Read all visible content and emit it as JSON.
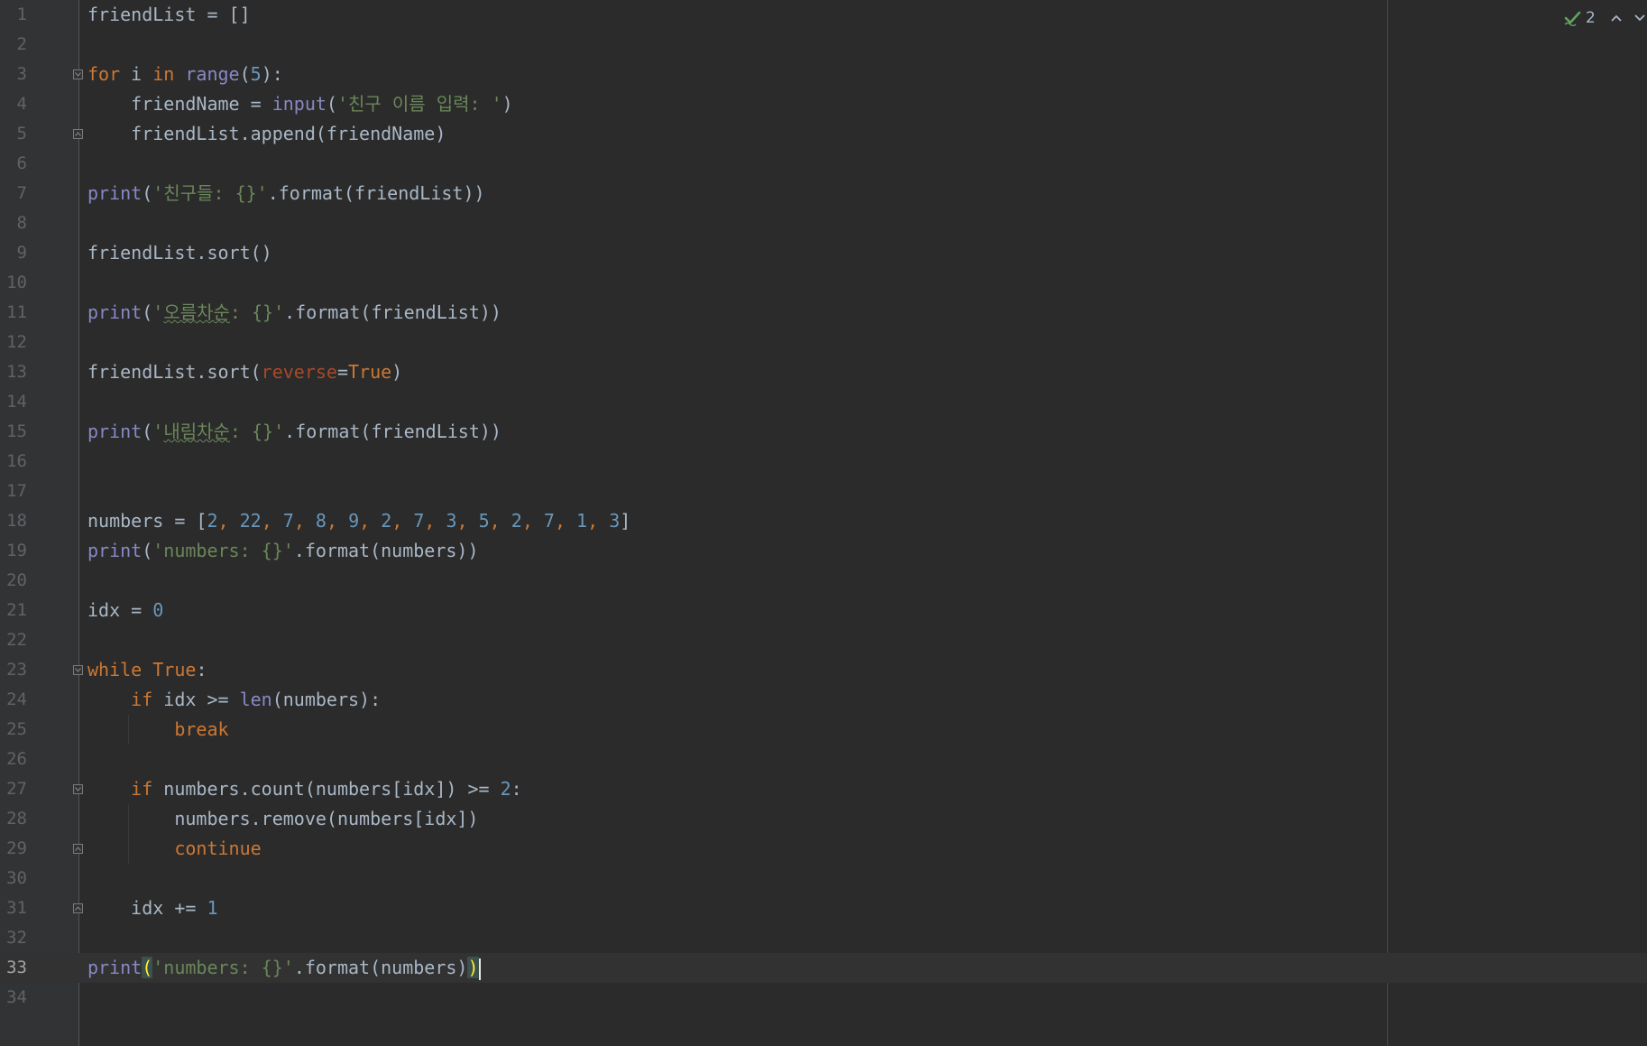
{
  "inspections": {
    "icon": "check-warning-icon",
    "count": "2",
    "prev_icon": "chevron-up-icon",
    "next_icon": "chevron-down-icon"
  },
  "current_line": 33,
  "lines": [
    {
      "n": "1",
      "tokens": [
        {
          "t": "friendList = []",
          "c": "default"
        }
      ]
    },
    {
      "n": "2",
      "tokens": []
    },
    {
      "n": "3",
      "fold": "start",
      "tokens": [
        {
          "t": "for",
          "c": "keyword"
        },
        {
          "t": " i ",
          "c": "default"
        },
        {
          "t": "in",
          "c": "keyword"
        },
        {
          "t": " ",
          "c": "default"
        },
        {
          "t": "range",
          "c": "builtin"
        },
        {
          "t": "(",
          "c": "default"
        },
        {
          "t": "5",
          "c": "number"
        },
        {
          "t": "):",
          "c": "default"
        }
      ]
    },
    {
      "n": "4",
      "tokens": [
        {
          "t": "    friendName = ",
          "c": "default"
        },
        {
          "t": "input",
          "c": "builtin"
        },
        {
          "t": "(",
          "c": "default"
        },
        {
          "t": "'친구 이름 입력: '",
          "c": "string"
        },
        {
          "t": ")",
          "c": "default"
        }
      ]
    },
    {
      "n": "5",
      "fold": "end",
      "tokens": [
        {
          "t": "    friendList.append(friendName)",
          "c": "default"
        }
      ]
    },
    {
      "n": "6",
      "tokens": []
    },
    {
      "n": "7",
      "tokens": [
        {
          "t": "print",
          "c": "builtin"
        },
        {
          "t": "(",
          "c": "default"
        },
        {
          "t": "'친구들: {}'",
          "c": "string"
        },
        {
          "t": ".format(friendList))",
          "c": "default"
        }
      ]
    },
    {
      "n": "8",
      "tokens": []
    },
    {
      "n": "9",
      "tokens": [
        {
          "t": "friendList.sort()",
          "c": "default"
        }
      ]
    },
    {
      "n": "10",
      "tokens": []
    },
    {
      "n": "11",
      "tokens": [
        {
          "t": "print",
          "c": "builtin"
        },
        {
          "t": "(",
          "c": "default"
        },
        {
          "t": "'",
          "c": "string"
        },
        {
          "t": "오름차순",
          "c": "korean"
        },
        {
          "t": ": {}'",
          "c": "string"
        },
        {
          "t": ".format(friendList))",
          "c": "default"
        }
      ]
    },
    {
      "n": "12",
      "tokens": []
    },
    {
      "n": "13",
      "tokens": [
        {
          "t": "friendList.sort(",
          "c": "default"
        },
        {
          "t": "reverse",
          "c": "param"
        },
        {
          "t": "=",
          "c": "default"
        },
        {
          "t": "True",
          "c": "keyword"
        },
        {
          "t": ")",
          "c": "default"
        }
      ]
    },
    {
      "n": "14",
      "tokens": []
    },
    {
      "n": "15",
      "tokens": [
        {
          "t": "print",
          "c": "builtin"
        },
        {
          "t": "(",
          "c": "default"
        },
        {
          "t": "'",
          "c": "string"
        },
        {
          "t": "내림차순",
          "c": "korean"
        },
        {
          "t": ": {}'",
          "c": "string"
        },
        {
          "t": ".format(friendList))",
          "c": "default"
        }
      ]
    },
    {
      "n": "16",
      "tokens": []
    },
    {
      "n": "17",
      "tokens": []
    },
    {
      "n": "18",
      "tokens": [
        {
          "t": "numbers = [",
          "c": "default"
        },
        {
          "t": "2",
          "c": "number"
        },
        {
          "t": ", ",
          "c": "punct"
        },
        {
          "t": "22",
          "c": "number"
        },
        {
          "t": ", ",
          "c": "punct"
        },
        {
          "t": "7",
          "c": "number"
        },
        {
          "t": ", ",
          "c": "punct"
        },
        {
          "t": "8",
          "c": "number"
        },
        {
          "t": ", ",
          "c": "punct"
        },
        {
          "t": "9",
          "c": "number"
        },
        {
          "t": ", ",
          "c": "punct"
        },
        {
          "t": "2",
          "c": "number"
        },
        {
          "t": ", ",
          "c": "punct"
        },
        {
          "t": "7",
          "c": "number"
        },
        {
          "t": ", ",
          "c": "punct"
        },
        {
          "t": "3",
          "c": "number"
        },
        {
          "t": ", ",
          "c": "punct"
        },
        {
          "t": "5",
          "c": "number"
        },
        {
          "t": ", ",
          "c": "punct"
        },
        {
          "t": "2",
          "c": "number"
        },
        {
          "t": ", ",
          "c": "punct"
        },
        {
          "t": "7",
          "c": "number"
        },
        {
          "t": ", ",
          "c": "punct"
        },
        {
          "t": "1",
          "c": "number"
        },
        {
          "t": ", ",
          "c": "punct"
        },
        {
          "t": "3",
          "c": "number"
        },
        {
          "t": "]",
          "c": "default"
        }
      ]
    },
    {
      "n": "19",
      "tokens": [
        {
          "t": "print",
          "c": "builtin"
        },
        {
          "t": "(",
          "c": "default"
        },
        {
          "t": "'numbers: {}'",
          "c": "string"
        },
        {
          "t": ".format(numbers))",
          "c": "default"
        }
      ]
    },
    {
      "n": "20",
      "tokens": []
    },
    {
      "n": "21",
      "tokens": [
        {
          "t": "idx = ",
          "c": "default"
        },
        {
          "t": "0",
          "c": "number"
        }
      ]
    },
    {
      "n": "22",
      "tokens": []
    },
    {
      "n": "23",
      "fold": "start",
      "tokens": [
        {
          "t": "while",
          "c": "keyword"
        },
        {
          "t": " ",
          "c": "default"
        },
        {
          "t": "True",
          "c": "keyword"
        },
        {
          "t": ":",
          "c": "default"
        }
      ]
    },
    {
      "n": "24",
      "tokens": [
        {
          "t": "    ",
          "c": "default"
        },
        {
          "t": "if",
          "c": "keyword"
        },
        {
          "t": " idx >= ",
          "c": "default"
        },
        {
          "t": "len",
          "c": "builtin"
        },
        {
          "t": "(numbers):",
          "c": "default"
        }
      ]
    },
    {
      "n": "25",
      "tokens": [
        {
          "t": "        ",
          "c": "default"
        },
        {
          "t": "break",
          "c": "keyword"
        }
      ]
    },
    {
      "n": "26",
      "tokens": []
    },
    {
      "n": "27",
      "fold": "start",
      "tokens": [
        {
          "t": "    ",
          "c": "default"
        },
        {
          "t": "if",
          "c": "keyword"
        },
        {
          "t": " numbers.count(numbers[idx]) >= ",
          "c": "default"
        },
        {
          "t": "2",
          "c": "number"
        },
        {
          "t": ":",
          "c": "default"
        }
      ]
    },
    {
      "n": "28",
      "tokens": [
        {
          "t": "        numbers.remove(numbers[idx])",
          "c": "default"
        }
      ]
    },
    {
      "n": "29",
      "fold": "end",
      "tokens": [
        {
          "t": "        ",
          "c": "default"
        },
        {
          "t": "continue",
          "c": "keyword"
        }
      ]
    },
    {
      "n": "30",
      "tokens": []
    },
    {
      "n": "31",
      "fold": "end",
      "tokens": [
        {
          "t": "    idx += ",
          "c": "default"
        },
        {
          "t": "1",
          "c": "number"
        }
      ]
    },
    {
      "n": "32",
      "tokens": []
    },
    {
      "n": "33",
      "caret": true,
      "tokens": [
        {
          "t": "print",
          "c": "builtin"
        },
        {
          "t": "(",
          "c": "match"
        },
        {
          "t": "'numbers: {}'",
          "c": "string"
        },
        {
          "t": ".format(numbers)",
          "c": "default"
        },
        {
          "t": ")",
          "c": "match"
        }
      ]
    },
    {
      "n": "34",
      "tokens": []
    }
  ]
}
